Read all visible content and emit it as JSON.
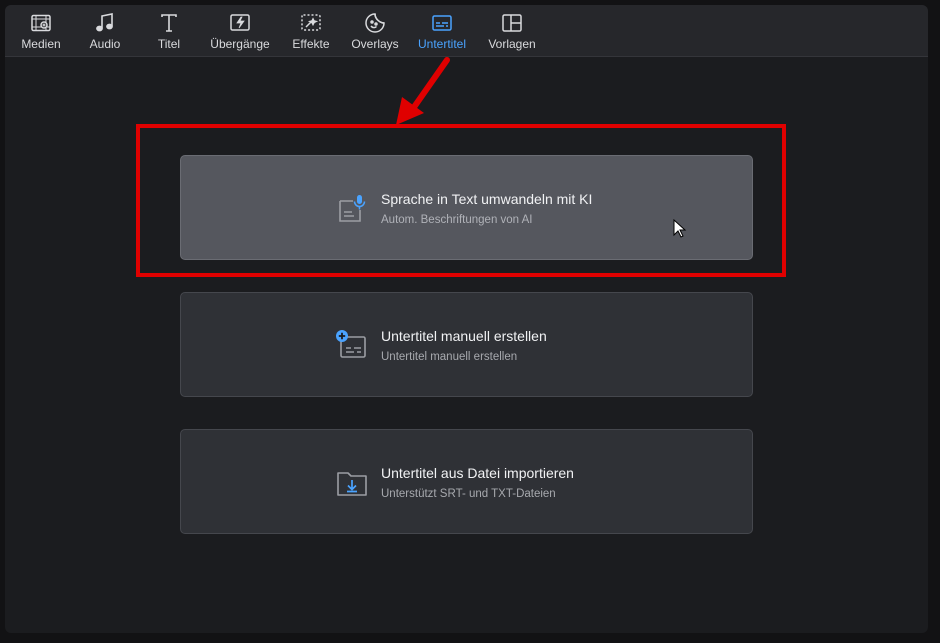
{
  "toolbar": {
    "tabs": [
      {
        "label": "Medien",
        "icon": "media-icon"
      },
      {
        "label": "Audio",
        "icon": "music-note-icon"
      },
      {
        "label": "Titel",
        "icon": "text-icon"
      },
      {
        "label": "Übergänge",
        "icon": "transition-icon"
      },
      {
        "label": "Effekte",
        "icon": "effects-icon"
      },
      {
        "label": "Overlays",
        "icon": "sticker-icon"
      },
      {
        "label": "Untertitel",
        "icon": "subtitle-icon"
      },
      {
        "label": "Vorlagen",
        "icon": "template-icon"
      }
    ],
    "active_tab": "Untertitel"
  },
  "options": [
    {
      "title": "Sprache in Text umwandeln mit KI",
      "subtitle": "Autom. Beschriftungen von AI",
      "icon": "speech-to-text-icon"
    },
    {
      "title": "Untertitel manuell erstellen",
      "subtitle": "Untertitel manuell erstellen",
      "icon": "add-subtitle-icon"
    },
    {
      "title": "Untertitel aus Datei importieren",
      "subtitle": "Unterstützt SRT- und TXT-Dateien",
      "icon": "import-folder-icon"
    }
  ],
  "colors": {
    "accent": "#4aa3ff",
    "annotation": "#e00000",
    "card_bg": "#2f3136",
    "card_hover_bg": "#55575e"
  }
}
